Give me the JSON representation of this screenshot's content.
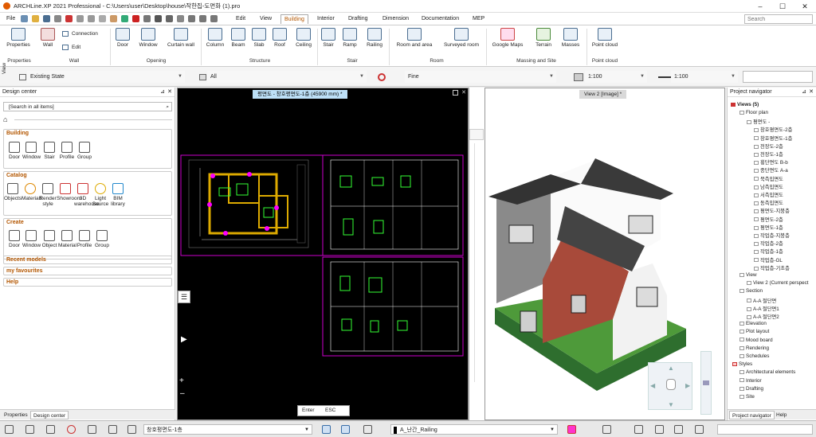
{
  "titlebar": {
    "title": "ARCHLine.XP 2021  Professional - C:\\Users\\user\\Desktop\\house\\작한집-도면화 (1).pro",
    "minimize": "–",
    "maximize": "☐",
    "close": "✕"
  },
  "menubar": {
    "file": "File",
    "tabs": [
      "Edit",
      "View",
      "Building",
      "Interior",
      "Drafting",
      "Dimension",
      "Documentation",
      "MEP"
    ],
    "active": "Building",
    "search_placeholder": "Search"
  },
  "ribbon": {
    "buttons": [
      "Properties",
      "Wall",
      "Connection",
      "Edit",
      "Door",
      "Window",
      "Curtain wall",
      "Column",
      "Beam",
      "Slab",
      "Roof",
      "Ceiling",
      "Stair",
      "Ramp",
      "Railing",
      "Room and area",
      "Surveyed room",
      "Google Maps",
      "Terrain",
      "Masses",
      "Point cloud"
    ],
    "groups": [
      "Properties",
      "Wall",
      "Opening",
      "Structure",
      "Stair",
      "Room",
      "Massing and Site",
      "Point cloud"
    ]
  },
  "propbar": {
    "view_label": "View",
    "state": "Existing State",
    "layer": "All",
    "line": "Fine",
    "scale1": "1:100",
    "scale2": "1:100"
  },
  "design_center": {
    "title": "Design center",
    "search_value": "[Search in all items]",
    "building": {
      "title": "Building",
      "items": [
        "Door",
        "Window",
        "Stair",
        "Profile",
        "Group"
      ]
    },
    "catalog": {
      "title": "Catalog",
      "items": [
        "Objects",
        "Materials",
        "Render style",
        "Showroom",
        "3D warehouse",
        "Light Source",
        "BIM library"
      ]
    },
    "create": {
      "title": "Create",
      "items": [
        "Door",
        "Window",
        "Object",
        "Material",
        "Profile",
        "Group"
      ]
    },
    "recent": "Recent models",
    "favourites": "my favourites",
    "help": "Help",
    "tabs": [
      "Properties",
      "Design center"
    ]
  },
  "view1": {
    "tab": "평면도 - 창호평면도-1층 (45900 mm) *",
    "cmd_enter": "Enter",
    "cmd_esc": "ESC"
  },
  "view2": {
    "tab": "View 2 [Image] *"
  },
  "navigator": {
    "title": "Project navigator",
    "root": "Views (5)",
    "items": [
      {
        "t": "Floor plan",
        "l": 1
      },
      {
        "t": "평면도 -",
        "l": 2
      },
      {
        "t": "창호평면도-2층",
        "l": 3
      },
      {
        "t": "창호평면도-1층",
        "l": 3
      },
      {
        "t": "천장도-2층",
        "l": 3
      },
      {
        "t": "천장도-1층",
        "l": 3
      },
      {
        "t": "횡단면도 B-b",
        "l": 3
      },
      {
        "t": "종단면도 A-a",
        "l": 3
      },
      {
        "t": "북측입면도",
        "l": 3
      },
      {
        "t": "남측입면도",
        "l": 3
      },
      {
        "t": "서측입면도",
        "l": 3
      },
      {
        "t": "동측입면도",
        "l": 3
      },
      {
        "t": "평면도-지붕층",
        "l": 3
      },
      {
        "t": "평면도-2층",
        "l": 3
      },
      {
        "t": "평면도-1층",
        "l": 3
      },
      {
        "t": "작업층-지붕층",
        "l": 3
      },
      {
        "t": "작업층-2층",
        "l": 3
      },
      {
        "t": "작업층-1층",
        "l": 3
      },
      {
        "t": "작업층-GL",
        "l": 3
      },
      {
        "t": "작업층-기초층",
        "l": 3
      },
      {
        "t": "View",
        "l": 1
      },
      {
        "t": "View 2 (Current perspect",
        "l": 2
      },
      {
        "t": "Section",
        "l": 1
      },
      {
        "t": "A-A 절단면",
        "l": 2
      },
      {
        "t": "A-A 절단면1",
        "l": 2
      },
      {
        "t": "A-A 절단면2",
        "l": 2
      },
      {
        "t": "Elevation",
        "l": 1
      },
      {
        "t": "Plot layout",
        "l": 1
      },
      {
        "t": "Mood board",
        "l": 1
      },
      {
        "t": "Rendering",
        "l": 1
      },
      {
        "t": "Schedules",
        "l": 1
      },
      {
        "t": "Styles",
        "l": 0
      },
      {
        "t": "Architectural elements",
        "l": 1
      },
      {
        "t": "Interior",
        "l": 1
      },
      {
        "t": "Drafting",
        "l": 1
      },
      {
        "t": "Site",
        "l": 1
      }
    ],
    "tabs": [
      "Project navigator",
      "Help"
    ]
  },
  "statusbar": {
    "floor": "창호평면도-1층",
    "layer": "A_난간_Railing"
  }
}
